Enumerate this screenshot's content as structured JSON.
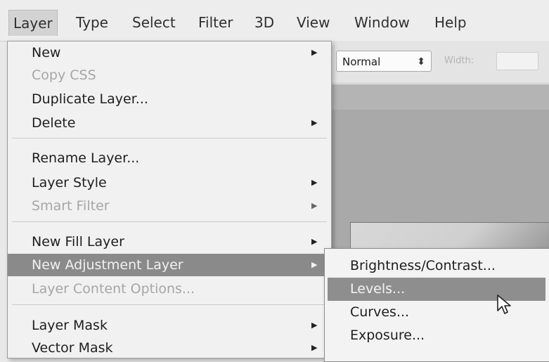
{
  "menubar": {
    "items": [
      {
        "label": "Layer",
        "active": true
      },
      {
        "label": "Type"
      },
      {
        "label": "Select"
      },
      {
        "label": "Filter"
      },
      {
        "label": "3D"
      },
      {
        "label": "View"
      },
      {
        "label": "Window"
      },
      {
        "label": "Help"
      }
    ]
  },
  "options_bar": {
    "mode_value": "Normal",
    "mode_arrows": "⬍",
    "width_label": "Width:"
  },
  "layer_menu": {
    "items": [
      {
        "label": "New",
        "submenu": true,
        "enabled": true
      },
      {
        "label": "Copy CSS",
        "submenu": false,
        "enabled": false
      },
      {
        "label": "Duplicate Layer...",
        "submenu": false,
        "enabled": true
      },
      {
        "label": "Delete",
        "submenu": true,
        "enabled": true
      },
      {
        "label": "Rename Layer...",
        "submenu": false,
        "enabled": true
      },
      {
        "label": "Layer Style",
        "submenu": true,
        "enabled": true
      },
      {
        "label": "Smart Filter",
        "submenu": true,
        "enabled": false
      },
      {
        "label": "New Fill Layer",
        "submenu": true,
        "enabled": true
      },
      {
        "label": "New Adjustment Layer",
        "submenu": true,
        "enabled": true,
        "highlighted": true
      },
      {
        "label": "Layer Content Options...",
        "submenu": false,
        "enabled": false
      },
      {
        "label": "Layer Mask",
        "submenu": true,
        "enabled": true
      },
      {
        "label": "Vector Mask",
        "submenu": true,
        "enabled": true
      }
    ],
    "arrow_glyph": "▶"
  },
  "adjustment_submenu": {
    "items": [
      {
        "label": "Brightness/Contrast..."
      },
      {
        "label": "Levels...",
        "highlighted": true
      },
      {
        "label": "Curves..."
      },
      {
        "label": "Exposure..."
      }
    ]
  },
  "colors": {
    "menu_bg": "#f1f1f1",
    "highlight_bg": "#8a8a8a",
    "disabled_text": "#a6a6a6"
  },
  "icons": {
    "cursor": "mouse-pointer-icon",
    "submenu_arrow": "submenu-arrow-icon"
  }
}
